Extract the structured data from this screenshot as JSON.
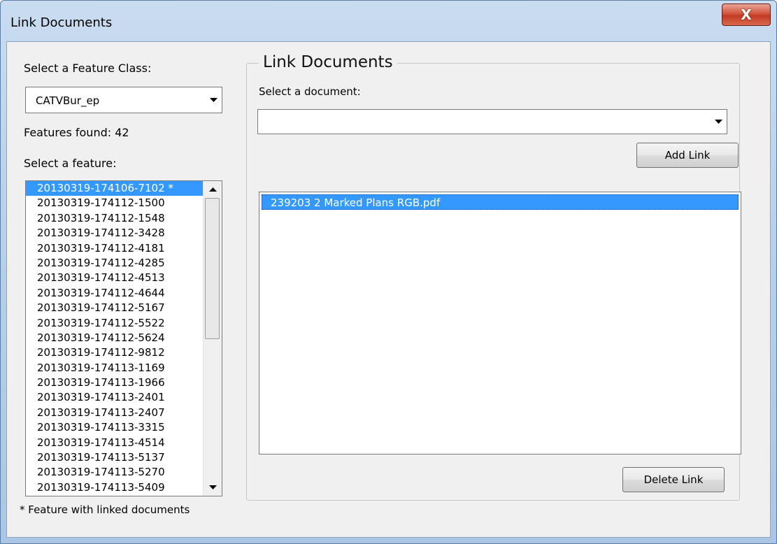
{
  "window": {
    "title": "Link Documents",
    "close_glyph": "X"
  },
  "left_panel": {
    "feature_class_label": "Select a Feature Class:",
    "feature_class_value": "CATVBur_ep",
    "features_found": "Features found: 42",
    "select_feature_label": "Select a feature:",
    "features": [
      "20130319-174106-7102 *",
      "20130319-174112-1500",
      "20130319-174112-1548",
      "20130319-174112-3428",
      "20130319-174112-4181",
      "20130319-174112-4285",
      "20130319-174112-4513",
      "20130319-174112-4644",
      "20130319-174112-5167",
      "20130319-174112-5522",
      "20130319-174112-5624",
      "20130319-174112-9812",
      "20130319-174113-1169",
      "20130319-174113-1966",
      "20130319-174113-2401",
      "20130319-174113-2407",
      "20130319-174113-3315",
      "20130319-174113-4514",
      "20130319-174113-5137",
      "20130319-174113-5270",
      "20130319-174113-5409"
    ],
    "selected_feature_index": 0,
    "footnote": "* Feature with linked documents"
  },
  "right_panel": {
    "group_title": "Link Documents",
    "select_document_label": "Select a document:",
    "document_value": "",
    "add_link_label": "Add Link",
    "linked_documents": [
      "239203 2 Marked Plans RGB.pdf"
    ],
    "delete_link_label": "Delete Link"
  },
  "icons": {
    "dropdown": "chevron-down-icon",
    "scroll_up": "arrow-up-icon",
    "scroll_down": "arrow-down-icon",
    "close": "close-icon"
  },
  "colors": {
    "selection": "#3399ff",
    "dialog_bg": "#f0f0f0",
    "close_button": "#c23a22"
  }
}
